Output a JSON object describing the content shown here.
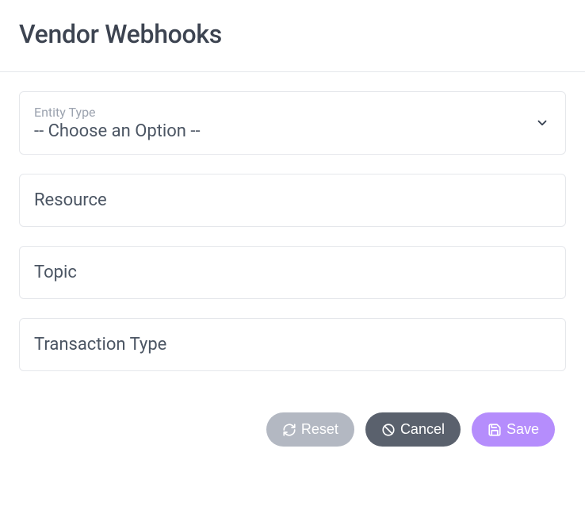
{
  "header": {
    "title": "Vendor Webhooks"
  },
  "form": {
    "entity_type": {
      "label": "Entity Type",
      "value": "-- Choose an Option --"
    },
    "resource": {
      "label": "Resource"
    },
    "topic": {
      "label": "Topic"
    },
    "transaction_type": {
      "label": "Transaction Type"
    }
  },
  "buttons": {
    "reset": "Reset",
    "cancel": "Cancel",
    "save": "Save"
  }
}
